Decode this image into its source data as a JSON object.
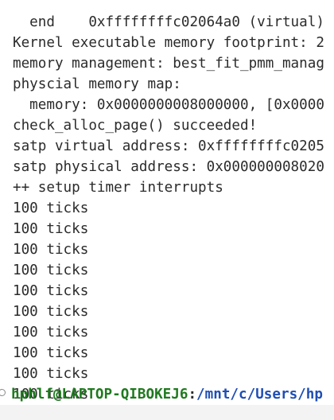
{
  "terminal": {
    "lines": [
      "  end    0xffffffffc02064a0 (virtual)",
      "Kernel executable memory footprint: 2",
      "memory management: best_fit_pmm_manag",
      "physcial memory map:",
      "  memory: 0x0000000008000000, [0x0000",
      "check_alloc_page() succeeded!",
      "satp virtual address: 0xffffffffc0205",
      "satp physical address: 0x000000008020",
      "++ setup timer interrupts",
      "100 ticks",
      "100 ticks",
      "100 ticks",
      "100 ticks",
      "100 ticks",
      "100 ticks",
      "100 ticks",
      "100 ticks",
      "100 ticks",
      "100 ticks"
    ],
    "prompt": {
      "user_host": "hphlf@LAPTOP-QIBOKEJ6",
      "separator": ":",
      "path": "/mnt/c/Users/hp"
    }
  },
  "colors": {
    "background": "#ffffff",
    "text": "#2b2b2b",
    "user_host": "#1f7a1f",
    "path": "#1f4fb5"
  }
}
